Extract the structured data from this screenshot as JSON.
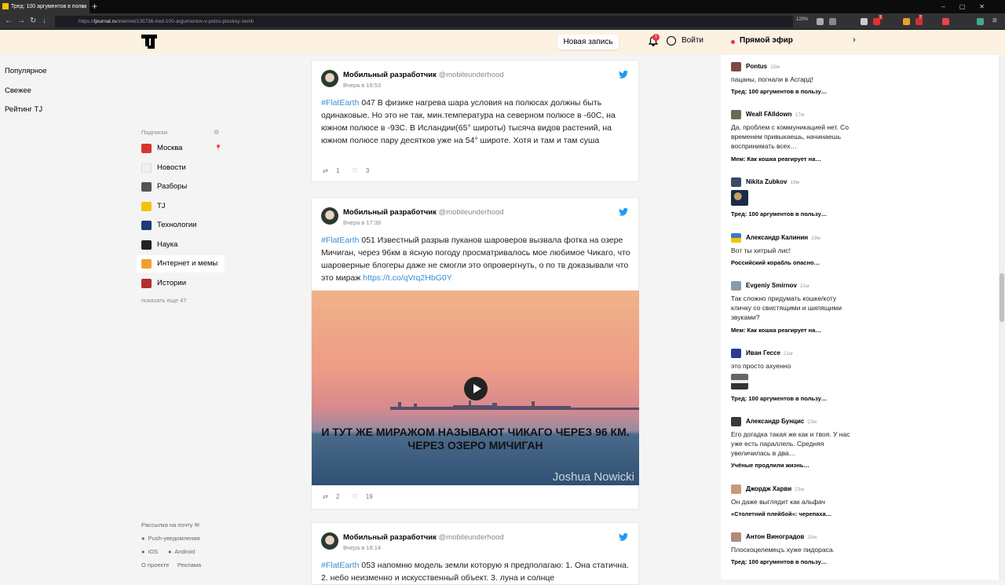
{
  "browser": {
    "tab_title": "Тред: 100 аргументов в польз",
    "url_prefix": "https://",
    "url_domain": "tjournal.ru",
    "url_path": "/internet/135736-tred-100-argumentov-v-polzu-ploskoy-zemli",
    "zoom": "120%",
    "badge1": "1",
    "badge2": "2"
  },
  "header": {
    "new_post": "Новая запись",
    "notif_count": "1",
    "login": "Войти",
    "live": "Прямой эфир"
  },
  "left_nav": {
    "main": [
      "Популярное",
      "Свежее",
      "Рейтинг TJ"
    ],
    "subs_label": "Подписки",
    "subs": [
      {
        "label": "Москва",
        "color": "#d9352b"
      },
      {
        "label": "Новости",
        "color": "#f0f0f0"
      },
      {
        "label": "Разборы",
        "color": "#555555"
      },
      {
        "label": "TJ",
        "color": "#f4c400"
      },
      {
        "label": "Технологии",
        "color": "#1e3a78"
      },
      {
        "label": "Наука",
        "color": "#222222"
      },
      {
        "label": "Интернет и мемы",
        "color": "#f0a030"
      },
      {
        "label": "Истории",
        "color": "#b0302a"
      }
    ],
    "show_more": "показать еще 47",
    "newsletter": "Рассылка на почту",
    "push": "Push-уведомления",
    "ios": "iOS",
    "android": "Android",
    "about": "О проекте",
    "ads": "Реклама"
  },
  "tweets": [
    {
      "author": "Мобильный разработчик",
      "handle": "@mobileunderhood",
      "time": "Вчера в 16:53",
      "tag": "#FlatEarth",
      "text": " 047 В физике нагрева шара условия на полюсах должны быть одинаковые. Но это не так, мин.температура на северном полюсе в -60С, на южном полюсе в -93С. В Исландии(65° широты) тысяча видов растений, на южном полюсе пару десятков уже на 54° широте. Хотя и там и там суша",
      "retweets": "1",
      "likes": "3"
    },
    {
      "author": "Мобильный разработчик",
      "handle": "@mobileunderhood",
      "time": "Вчера в 17:39",
      "tag": "#FlatEarth",
      "text": " 051 Известный разрыв пуканов шароверов вызвала фотка на озере Мичиган, через 96км в ясную погоду просматривалось мое любимое Чикаго, что шароверные блогеры даже не смогли это опровергнуть, о по тв доказывали что это мираж ",
      "link": "https://t.co/qVrq2HbG0Y",
      "media_text": "И ТУТ ЖЕ МИРАЖОМ НАЗЫВАЮТ ЧИКАГО ЧЕРЕЗ 96 КМ. ЧЕРЕЗ ОЗЕРО МИЧИГАН",
      "watermark": "Joshua Nowicki",
      "retweets": "2",
      "likes": "19"
    },
    {
      "author": "Мобильный разработчик",
      "handle": "@mobileunderhood",
      "time": "Вчера в 18:14",
      "tag": "#FlatEarth",
      "text": " 053 напомню модель земли которую я предполагаю: 1. Она статична. 2. небо неизменно и искусственный объект. 3. луна и солнце"
    }
  ],
  "comments": [
    {
      "name": "Pontus",
      "time": "15м",
      "text": "пацаны, погнали в Асгард!",
      "thread": "Тред: 100 аргументов в пользу…",
      "color": "#7a4a4a"
    },
    {
      "name": "Weall FAlldown",
      "time": "17м",
      "text": "Да, проблем с коммуникацией нет. Со временем привыкаешь, начинаешь воспринимать всех…",
      "thread": "Мем: Как кошка реагирует на…",
      "color": "#6a6a5a"
    },
    {
      "name": "Nikita Zubkov",
      "time": "19м",
      "text": "",
      "thread": "Тред: 100 аргументов в пользу…",
      "color": "#3a4a6a"
    },
    {
      "name": "Александр Калинин",
      "time": "19м",
      "text": "Вот ты хитрый лис!",
      "thread": "Российский корабль опасно…",
      "color": "#3a7ac8"
    },
    {
      "name": "Evgeniy Smirnov",
      "time": "21м",
      "text": "Так сложно придумать кошке/коту кличку со свистящими и шипящими звуками?",
      "thread": "Мем: Как кошка реагирует на…",
      "color": "#8a9aa8"
    },
    {
      "name": "Иван Гессе",
      "time": "21м",
      "text": "это просто ахуенно",
      "thread": "Тред: 100 аргументов в пользу…",
      "color": "#2a3a9a"
    },
    {
      "name": "Александр Бунцис",
      "time": "23м",
      "text": "Его догадка такая же как и твоя. У нас уже есть параллель. Средняя увеличилась в два…",
      "thread": "Учёные продлили жизнь…",
      "color": "#3a3a3a"
    },
    {
      "name": "Джордж Харви",
      "time": "23м",
      "text": "Он даже выглядит как альфач",
      "thread": "«Столетний плейбой»: черепаха…",
      "color": "#c89a7a"
    },
    {
      "name": "Антон Виноградов",
      "time": "25м",
      "text": "Плоскоцелемецъ хуже пидораса.",
      "thread": "Тред: 100 аргументов в пользу…",
      "color": "#b08a7a"
    }
  ]
}
